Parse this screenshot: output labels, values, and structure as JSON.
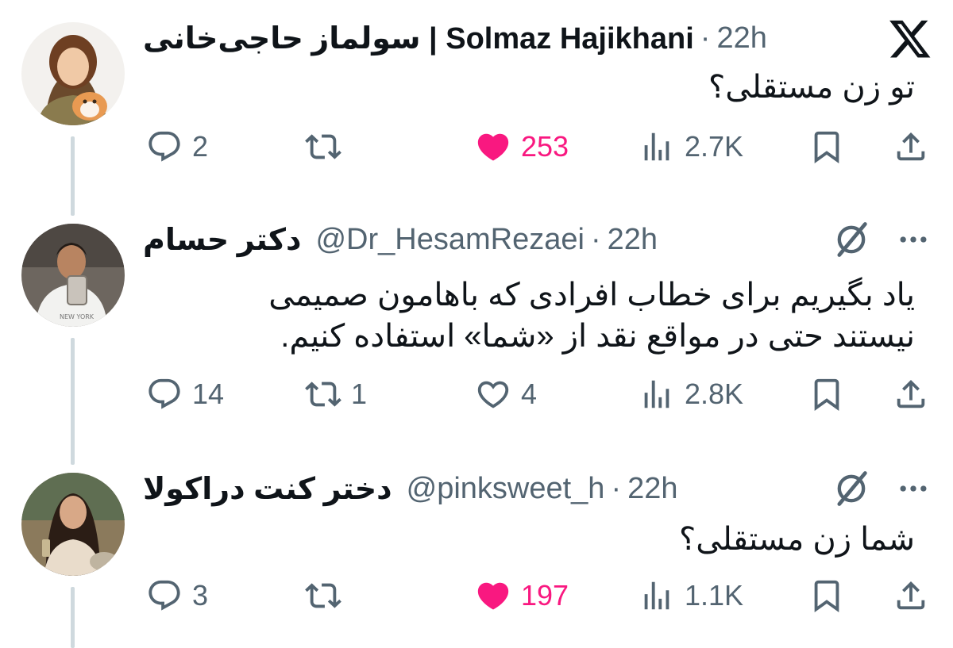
{
  "colors": {
    "text": "#0f1419",
    "muted": "#536471",
    "like": "#f91880",
    "thread_line": "#cfd9de"
  },
  "icons": {
    "brand": "x-logo-icon",
    "reply": "reply-icon",
    "repost": "repost-icon",
    "like": "heart-icon",
    "views": "views-icon",
    "bookmark": "bookmark-icon",
    "share": "share-icon",
    "grok": "grok-icon",
    "more": "more-icon"
  },
  "tweets": [
    {
      "name": "Solmaz Hajikhani | سولماز حاجی‌خانی",
      "dot": "·",
      "time": "22h",
      "text": "تو زن مستقلی؟",
      "reply_count": "2",
      "repost_count": "",
      "like_count": "253",
      "liked": true,
      "views": "2.7K"
    },
    {
      "name": "دکتر حسام",
      "handle": "@Dr_HesamRezaei",
      "dot": "·",
      "time": "22h",
      "text": "یاد بگیریم برای خطاب افرادی که باهامون صمیمی نیستند حتی در مواقع نقد از «شما» استفاده کنیم.",
      "reply_count": "14",
      "repost_count": "1",
      "like_count": "4",
      "liked": false,
      "views": "2.8K"
    },
    {
      "name": "دختر کنت دراکولا",
      "handle": "@pinksweet_h",
      "dot": "·",
      "time": "22h",
      "text": "شما زن مستقلی؟",
      "reply_count": "3",
      "repost_count": "",
      "like_count": "197",
      "liked": true,
      "views": "1.1K"
    }
  ]
}
